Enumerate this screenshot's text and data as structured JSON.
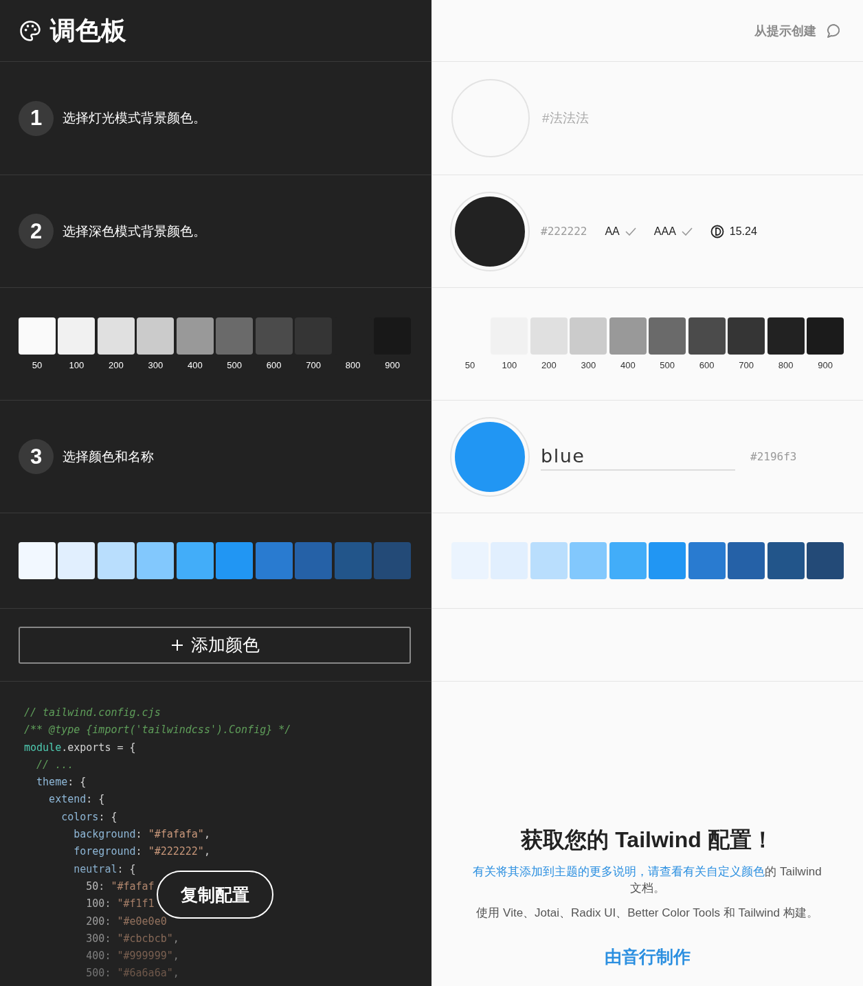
{
  "header": {
    "title": "调色板",
    "action": "从提示创建"
  },
  "steps": [
    {
      "number": "1",
      "label": "选择灯光模式背景颜色。"
    },
    {
      "number": "2",
      "label": "选择深色模式背景颜色。"
    },
    {
      "number": "3",
      "label": "选择颜色和名称"
    }
  ],
  "light_background": {
    "placeholder": "#法法法"
  },
  "dark_background": {
    "hex": "#222222",
    "checks": [
      {
        "label": "AA",
        "passed": true
      },
      {
        "label": "AAA",
        "passed": true
      }
    ],
    "contrast": "15.24"
  },
  "neutral_dark": [
    {
      "label": "50",
      "color": "#fafafa"
    },
    {
      "label": "100",
      "color": "#f1f1f1"
    },
    {
      "label": "200",
      "color": "#e0e0e0"
    },
    {
      "label": "300",
      "color": "#cbcbcb"
    },
    {
      "label": "400",
      "color": "#999999"
    },
    {
      "label": "500",
      "color": "#6a6a6a"
    },
    {
      "label": "600",
      "color": "#4b4b4b"
    },
    {
      "label": "700",
      "color": "#353535"
    },
    {
      "label": "800",
      "color": "#222222"
    },
    {
      "label": "900",
      "color": "#181818"
    }
  ],
  "neutral_light": [
    {
      "label": "50",
      "color": "#fafafa"
    },
    {
      "label": "100",
      "color": "#f1f1f1"
    },
    {
      "label": "200",
      "color": "#e0e0e0"
    },
    {
      "label": "300",
      "color": "#cbcbcb"
    },
    {
      "label": "400",
      "color": "#999999"
    },
    {
      "label": "500",
      "color": "#6a6a6a"
    },
    {
      "label": "600",
      "color": "#4b4b4b"
    },
    {
      "label": "700",
      "color": "#353535"
    },
    {
      "label": "800",
      "color": "#222222"
    },
    {
      "label": "900",
      "color": "#1b1b1b"
    }
  ],
  "color": {
    "name": "blue",
    "hex": "#2196f3"
  },
  "blue_dark": [
    {
      "color": "#f2f8ff"
    },
    {
      "color": "#e1effe"
    },
    {
      "color": "#b9defd"
    },
    {
      "color": "#82c8fd"
    },
    {
      "color": "#42adf9"
    },
    {
      "color": "#2196f3"
    },
    {
      "color": "#297bd0"
    },
    {
      "color": "#2561a7"
    },
    {
      "color": "#22558a"
    },
    {
      "color": "#234a77"
    }
  ],
  "blue_light": [
    {
      "color": "#ebf4fe"
    },
    {
      "color": "#e1effe"
    },
    {
      "color": "#b9defd"
    },
    {
      "color": "#82c8fd"
    },
    {
      "color": "#42adf9"
    },
    {
      "color": "#2196f3"
    },
    {
      "color": "#297bd0"
    },
    {
      "color": "#2561a7"
    },
    {
      "color": "#22558a"
    },
    {
      "color": "#234a77"
    }
  ],
  "add_button": "添加颜色",
  "code": [
    [
      {
        "kind": "comment",
        "text": "// tailwind.config.cjs"
      }
    ],
    [
      {
        "kind": "comment",
        "text": "/** @type {import('tailwindcss').Config} */"
      }
    ],
    [
      {
        "kind": "object",
        "text": "module"
      },
      {
        "kind": "plain",
        "text": ".exports = {"
      }
    ],
    [
      {
        "kind": "comment",
        "text": "  // ..."
      }
    ],
    [
      {
        "kind": "property",
        "text": "  theme"
      },
      {
        "kind": "plain",
        "text": ": {"
      }
    ],
    [
      {
        "kind": "property",
        "text": "    extend"
      },
      {
        "kind": "plain",
        "text": ": {"
      }
    ],
    [
      {
        "kind": "property",
        "text": "      colors"
      },
      {
        "kind": "plain",
        "text": ": {"
      }
    ],
    [
      {
        "kind": "property",
        "text": "        background"
      },
      {
        "kind": "plain",
        "text": ": "
      },
      {
        "kind": "string",
        "text": "\"#fafafa\""
      },
      {
        "kind": "plain",
        "text": ","
      }
    ],
    [
      {
        "kind": "property",
        "text": "        foreground"
      },
      {
        "kind": "plain",
        "text": ": "
      },
      {
        "kind": "string",
        "text": "\"#222222\""
      },
      {
        "kind": "plain",
        "text": ","
      }
    ],
    [
      {
        "kind": "property",
        "text": "        neutral"
      },
      {
        "kind": "plain",
        "text": ": {"
      }
    ],
    [
      {
        "kind": "plain",
        "text": "          50: "
      },
      {
        "kind": "string",
        "text": "\"#fafaf"
      }
    ],
    [
      {
        "kind": "plain",
        "text": "          100: "
      },
      {
        "kind": "string",
        "text": "\"#f1f1"
      }
    ],
    [
      {
        "kind": "plain",
        "text": "          200: "
      },
      {
        "kind": "string",
        "text": "\"#e0e0e0"
      }
    ],
    [
      {
        "kind": "plain",
        "text": "          300: "
      },
      {
        "kind": "string",
        "text": "\"#cbcbcb\""
      },
      {
        "kind": "plain",
        "text": ","
      }
    ],
    [
      {
        "kind": "plain",
        "text": "          400: "
      },
      {
        "kind": "string",
        "text": "\"#999999\""
      },
      {
        "kind": "plain",
        "text": ","
      }
    ],
    [
      {
        "kind": "plain",
        "text": "          500: "
      },
      {
        "kind": "string",
        "text": "\"#6a6a6a\""
      },
      {
        "kind": "plain",
        "text": ","
      }
    ]
  ],
  "copy_button": "复制配置",
  "footer": {
    "title": "获取您的 Tailwind 配置！",
    "docs_link": "有关将其添加到主题的更多说明，请查看有关自定义颜色",
    "docs_text": "的 Tailwind 文档。",
    "built_with": "使用 Vite、Jotai、Radix UI、Better Color Tools 和 Tailwind 构建。",
    "credit": "由音行制作"
  }
}
